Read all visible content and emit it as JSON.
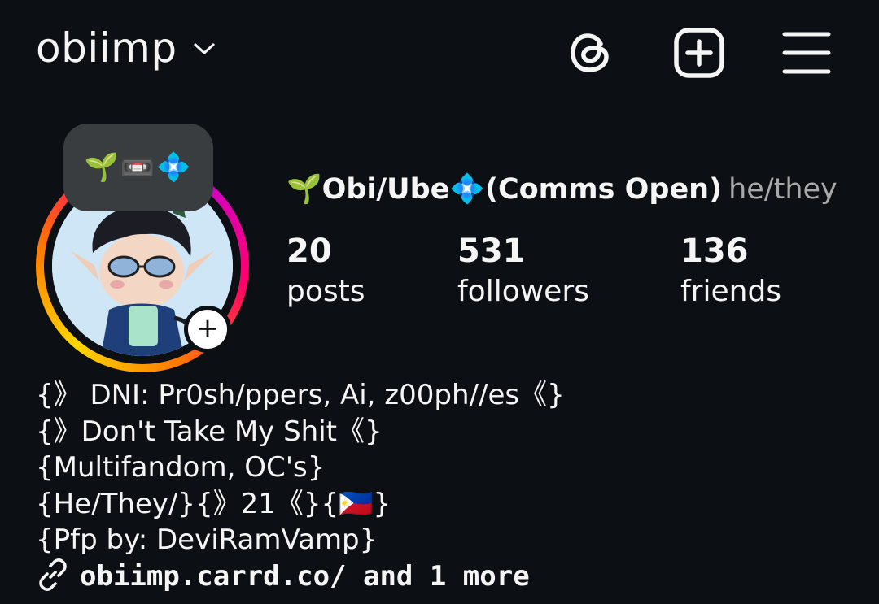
{
  "header": {
    "username": "obiimp",
    "icons": [
      "chevron-down-icon",
      "threads-icon",
      "plus-square-icon",
      "hamburger-menu-icon"
    ]
  },
  "note": {
    "text": "🌱📼💠"
  },
  "profile": {
    "display_name": "🌱Obi/Ube💠(Comms Open)",
    "pronouns": "he/they"
  },
  "stats": {
    "posts": {
      "count": "20",
      "label": "posts"
    },
    "followers": {
      "count": "531",
      "label": "followers"
    },
    "friends": {
      "count": "136",
      "label": "friends"
    }
  },
  "bio": {
    "lines": [
      "{》 DNI: Pr0sh/ppers, Ai, z00ph//es《}",
      "{》Don't Take My Shit《}",
      "{Multifandom, OC's}",
      "{He/They/}{》21《}{🇵🇭}",
      "{Pfp by: DeviRamVamp}"
    ],
    "link": "obiimp.carrd.co/ and 1 more"
  },
  "colors": {
    "background": "#0c1014",
    "text": "#f5f5f5",
    "muted": "#a8a8a8",
    "note_bubble": "#3a3d40"
  }
}
